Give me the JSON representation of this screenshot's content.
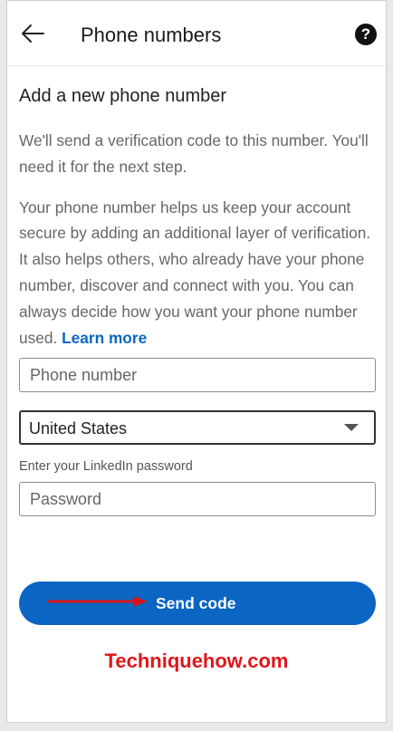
{
  "header": {
    "title": "Phone numbers",
    "back_icon": "arrow-left-icon",
    "help_icon": "question-circle-icon",
    "help_glyph": "?"
  },
  "content": {
    "section_title": "Add a new phone number",
    "intro_text": "We'll send a verification code to this number. You'll need it for the next step.",
    "info_text": "Your phone number helps us keep your account secure by adding an additional layer of verification. It also helps others, who already have your phone number, discover and connect with you. You can always decide how you want your phone number used. ",
    "learn_more_label": "Learn more"
  },
  "form": {
    "phone_placeholder": "Phone number",
    "phone_value": "",
    "country_selected": "United States",
    "password_label": "Enter your LinkedIn password",
    "password_placeholder": "Password",
    "password_value": ""
  },
  "actions": {
    "send_code_label": "Send code"
  },
  "watermark": {
    "text": "Techniquehow.com"
  },
  "colors": {
    "accent": "#0a66c2",
    "watermark": "#e0161a",
    "annotation_arrow": "#d7141b"
  }
}
